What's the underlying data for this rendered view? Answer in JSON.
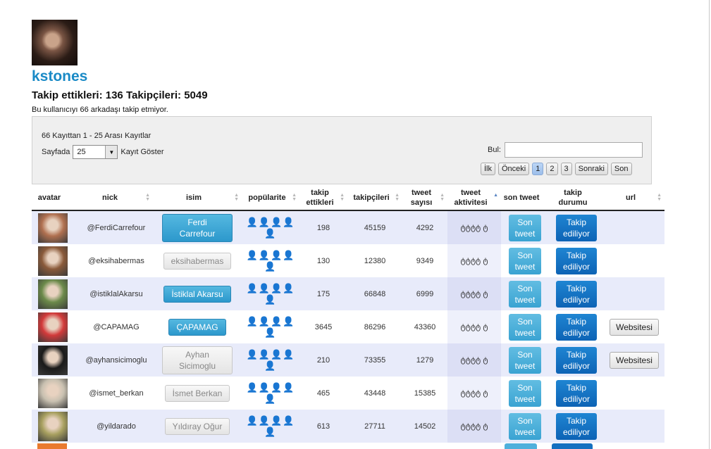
{
  "profile": {
    "username": "kstones",
    "counts": "Takip ettikleri: 136 Takipçileri: 5049",
    "note": "Bu kullanıcıyı 66 arkadaşı takip etmiyor."
  },
  "controls": {
    "info": "66 Kayıttan 1 - 25 Arası Kayıtlar",
    "per_page_prefix": "Sayfada",
    "per_page_value": "25",
    "per_page_suffix": "Kayıt Göster",
    "search_label": "Bul:",
    "search_value": "",
    "pager": [
      "İlk",
      "Önceki",
      "1",
      "2",
      "3",
      "Sonraki",
      "Son"
    ],
    "active_page": "1"
  },
  "columns": [
    "avatar",
    "nick",
    "isim",
    "popülarite",
    "takip ettikleri",
    "takipçileri",
    "tweet sayısı",
    "tweet aktivitesi",
    "son tweet",
    "takip durumu",
    "url"
  ],
  "rows": [
    {
      "nick": "@FerdiCarrefour",
      "name": "Ferdi Carrefour",
      "name_style": "blue",
      "popularity": "👤👤👤👤👤",
      "following": "198",
      "followers": "45159",
      "tweets": "4292",
      "son": "Son tweet",
      "status": "Takip ediliyor",
      "url": "",
      "avatar_color": "#b07050"
    },
    {
      "nick": "@eksihabermas",
      "name": "eksihabermas",
      "name_style": "grey",
      "popularity": "👤👤👤👤👤",
      "following": "130",
      "followers": "12380",
      "tweets": "9349",
      "son": "Son tweet",
      "status": "Takip ediliyor",
      "url": "",
      "avatar_color": "#8a5a3a"
    },
    {
      "nick": "@istiklalAkarsu",
      "name": "İstiklal Akarsu",
      "name_style": "blue",
      "popularity": "👤👤👤👤👤",
      "following": "175",
      "followers": "66848",
      "tweets": "6999",
      "son": "Son tweet",
      "status": "Takip ediliyor",
      "url": "",
      "avatar_color": "#6b8a4a"
    },
    {
      "nick": "@CAPAMAG",
      "name": "ÇAPAMAG",
      "name_style": "blue",
      "popularity": "👤👤👤👤👤",
      "following": "3645",
      "followers": "86296",
      "tweets": "43360",
      "son": "Son tweet",
      "status": "Takip ediliyor",
      "url": "Websitesi",
      "avatar_color": "#d23a3a"
    },
    {
      "nick": "@ayhansicimoglu",
      "name": "Ayhan Sicimoglu",
      "name_style": "grey",
      "popularity": "👤👤👤👤👤",
      "following": "210",
      "followers": "73355",
      "tweets": "1279",
      "son": "Son tweet",
      "status": "Takip ediliyor",
      "url": "Websitesi",
      "avatar_color": "#1a1a1a"
    },
    {
      "nick": "@ismet_berkan",
      "name": "İsmet Berkan",
      "name_style": "grey",
      "popularity": "👤👤👤👤👤",
      "following": "465",
      "followers": "43448",
      "tweets": "15385",
      "son": "Son tweet",
      "status": "Takip ediliyor",
      "url": "",
      "avatar_color": "#c8c0b0"
    },
    {
      "nick": "@yildarado",
      "name": "Yıldıray Oğur",
      "name_style": "grey",
      "popularity": "👤👤👤👤👤",
      "following": "613",
      "followers": "27711",
      "tweets": "14502",
      "son": "Son tweet",
      "status": "Takip ediliyor",
      "url": "",
      "avatar_color": "#a8a060"
    }
  ],
  "activity_glyph": "ტტტტ ტ"
}
